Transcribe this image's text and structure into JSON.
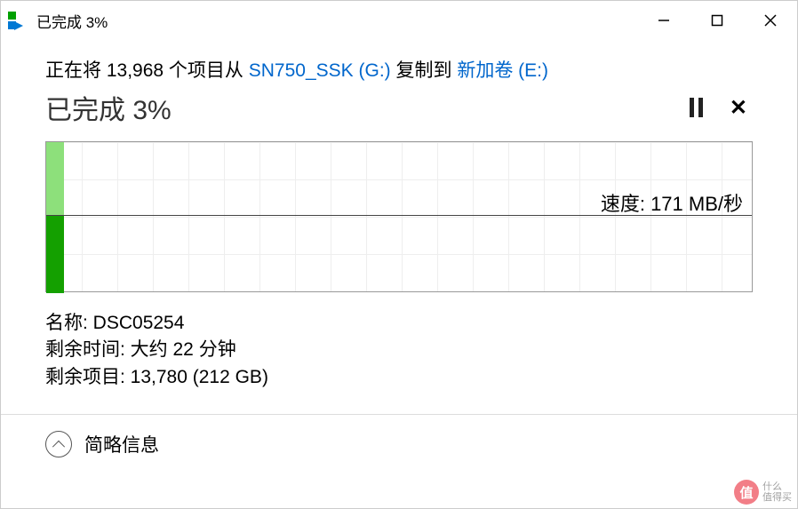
{
  "titlebar": {
    "title": "已完成 3%"
  },
  "copy_line": {
    "prefix": "正在将 ",
    "item_count": "13,968",
    "items_from": " 个项目从 ",
    "source": "SN750_SSK (G:)",
    "copy_to": " 复制到 ",
    "destination": "新加卷 (E:)"
  },
  "status": {
    "label": "已完成 3%"
  },
  "graph": {
    "speed_label": "速度: ",
    "speed_value": "171 MB/秒"
  },
  "details": {
    "name_label": "名称: ",
    "name_value": "DSC05254",
    "time_label": "剩余时间: ",
    "time_value": "大约 22 分钟",
    "items_label": "剩余项目: ",
    "items_value": "13,780 (212 GB)"
  },
  "footer": {
    "label": "简略信息"
  },
  "watermark": {
    "symbol": "值",
    "line1": "什么",
    "line2": "值得买"
  }
}
